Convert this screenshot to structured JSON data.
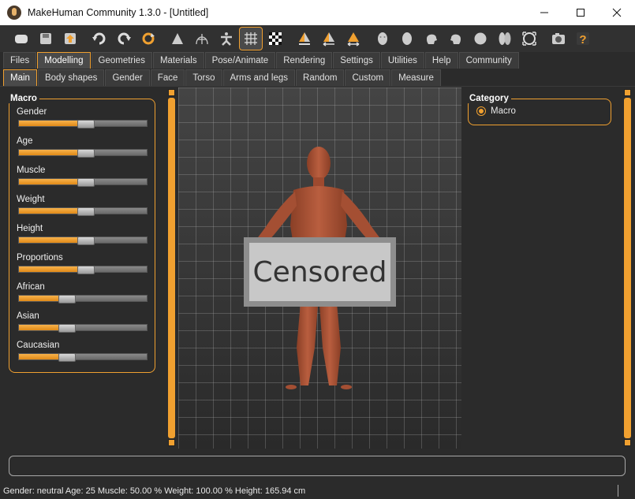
{
  "window": {
    "title": "MakeHuman Community 1.3.0 - [Untitled]",
    "controls": [
      "minimize-icon",
      "maximize-icon",
      "close-icon"
    ]
  },
  "toolbar": {
    "icons": [
      "load-icon",
      "save-icon",
      "export-icon",
      "undo-icon",
      "redo-icon",
      "reset-icon",
      "smooth-icon",
      "wireframe-icon",
      "pose-icon",
      "grid-icon",
      "checker-background-icon",
      "front-view-icon",
      "back-view-icon",
      "side-view-icon",
      "face-icon",
      "head-icon",
      "left-side-icon",
      "right-side-icon",
      "top-view-icon",
      "bottom-view-icon",
      "reset-camera-icon",
      "screenshot-icon",
      "help-icon"
    ],
    "active": "grid-icon"
  },
  "main_tabs": {
    "items": [
      "Files",
      "Modelling",
      "Geometries",
      "Materials",
      "Pose/Animate",
      "Rendering",
      "Settings",
      "Utilities",
      "Help",
      "Community"
    ],
    "selected": "Modelling"
  },
  "sub_tabs": {
    "items": [
      "Main",
      "Body shapes",
      "Gender",
      "Face",
      "Torso",
      "Arms and legs",
      "Random",
      "Custom",
      "Measure"
    ],
    "selected": "Main"
  },
  "macro": {
    "title": "Macro",
    "sliders": [
      {
        "label": "Gender",
        "value": 0.5
      },
      {
        "label": "Age",
        "value": 0.5
      },
      {
        "label": "Muscle",
        "value": 0.5
      },
      {
        "label": "Weight",
        "value": 0.5
      },
      {
        "label": "Height",
        "value": 0.5
      },
      {
        "label": "Proportions",
        "value": 0.5
      },
      {
        "label": "African",
        "value": 0.333
      },
      {
        "label": "Asian",
        "value": 0.333
      },
      {
        "label": "Caucasian",
        "value": 0.333
      }
    ]
  },
  "viewport": {
    "censor_text": "Censored"
  },
  "category": {
    "title": "Category",
    "option": "Macro"
  },
  "status": {
    "text": "Gender: neutral  Age: 25  Muscle: 50.00 %  Weight: 100.00 %  Height: 165.94 cm"
  },
  "colors": {
    "accent": "#f0a030",
    "background": "#2b2b2b",
    "skin": "#b55a3c"
  }
}
